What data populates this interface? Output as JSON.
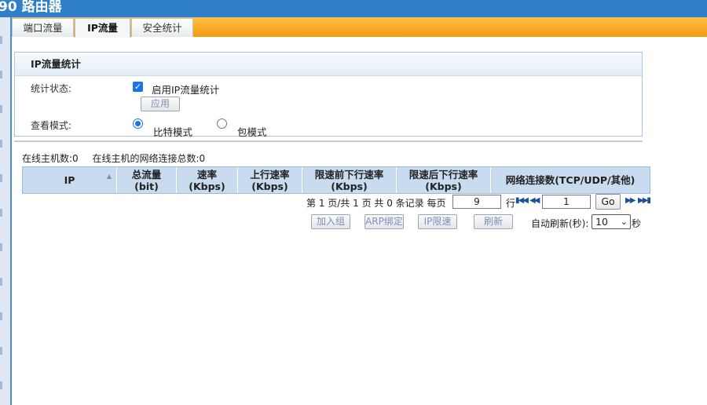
{
  "window": {
    "title": "90 路由器"
  },
  "tabs": [
    {
      "label": "端口流量"
    },
    {
      "label": "IP流量"
    },
    {
      "label": "安全统计"
    }
  ],
  "active_tab": "IP流量",
  "panel": {
    "title": "IP流量统计",
    "status_label": "统计状态:",
    "enable_label": "启用IP流量统计",
    "enable_checked": true,
    "apply_button": "应用",
    "view_mode_label": "查看模式:",
    "mode_bit": "比特模式",
    "mode_packet": "包模式",
    "selected_mode": "比特模式"
  },
  "summary": {
    "online_hosts": "在线主机数:0",
    "online_connections": "在线主机的网络连接总数:0"
  },
  "table": {
    "columns": [
      "IP",
      "总流量\n(bit)",
      "速率\n(Kbps)",
      "上行速率\n(Kbps)",
      "限速前下行速率\n(Kbps)",
      "限速后下行速率\n(Kbps)",
      "网络连接数(TCP/UDP/其他)"
    ],
    "rows": []
  },
  "pager": {
    "info": "第 1 页/共 1 页 共 0 条记录 每页",
    "per_page": "9",
    "row_unit": "行",
    "first_icon": "first-page-icon",
    "prev_icon": "prev-page-icon",
    "page_input": "1",
    "go_label": "Go",
    "next_icon": "next-page-icon",
    "last_icon": "last-page-icon"
  },
  "actions": {
    "add_group": "加入组",
    "arp_bind": "ARP绑定",
    "ip_limit": "IP限速",
    "refresh": "刷新",
    "auto_refresh_label": "自动刷新(秒):",
    "auto_refresh_value": "10",
    "seconds_unit": "秒"
  },
  "colors": {
    "title_bar": "#2f80c8",
    "tab_bar": "#f5a623",
    "table_header": "#c8dbef",
    "accent": "#1a73e8"
  }
}
